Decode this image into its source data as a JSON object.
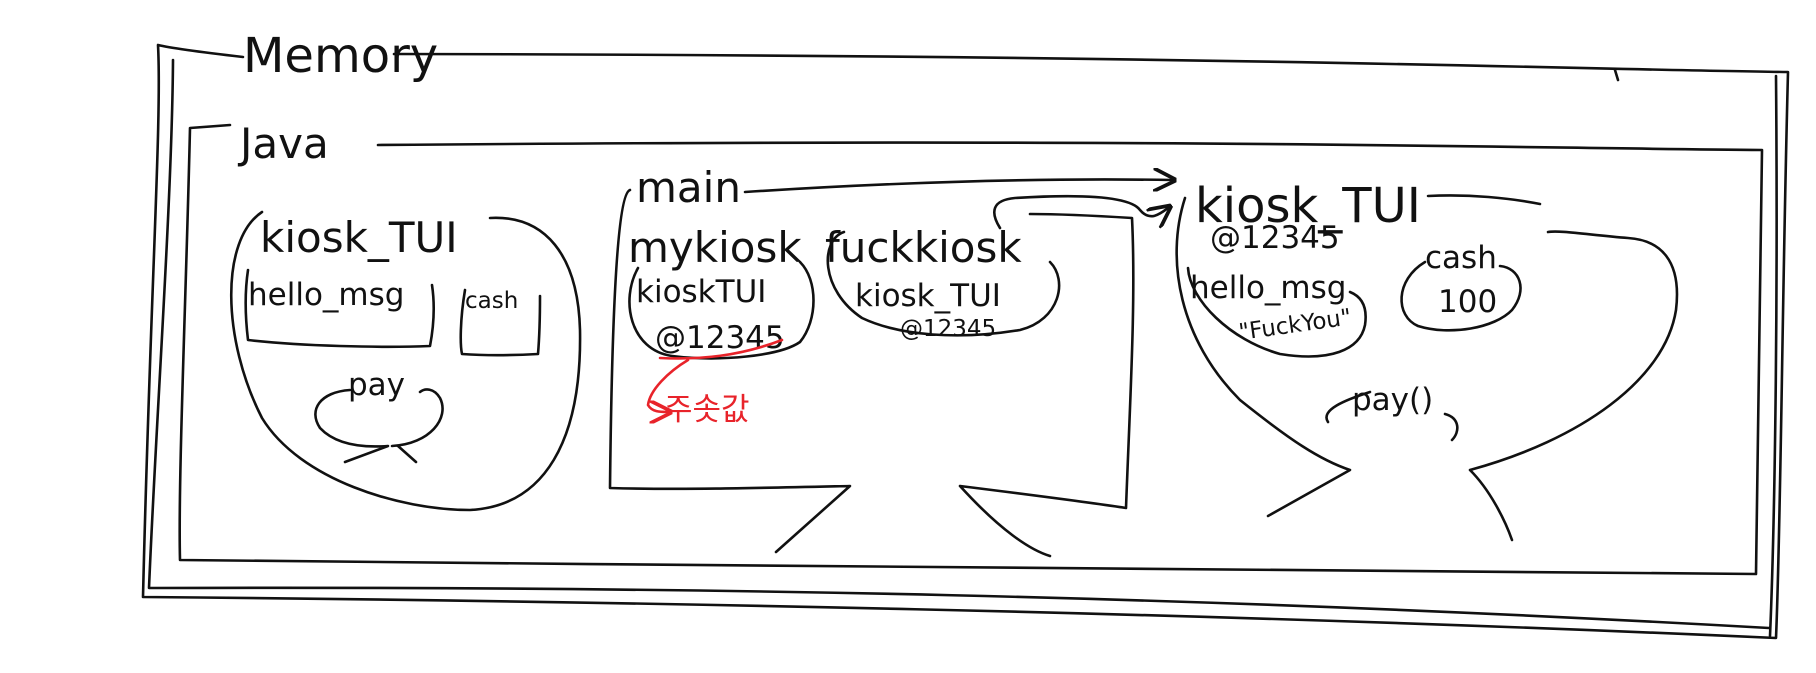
{
  "labels": {
    "memory": "Memory",
    "java": "Java",
    "class_area": {
      "class_name": "kiosk_TUI",
      "field_hello": "hello_msg",
      "field_cash": "cash",
      "method_pay": "pay"
    },
    "main_frame": {
      "title": "main",
      "var_mykiosk": "mykiosk",
      "mykiosk_type": "kioskTUI",
      "mykiosk_addr": "@12345",
      "address_note": "주솟값",
      "var_fuckkiosk": "fuckkiosk",
      "fuckkiosk_type": "kiosk_TUI",
      "fuckkiosk_addr": "@12345"
    },
    "instance": {
      "class_name": "kiosk_TUI",
      "address": "@12345",
      "field_hello": "hello_msg",
      "hello_value": "\"FuckYou\"",
      "field_cash": "cash",
      "cash_value": "100",
      "method_pay": "pay()"
    }
  },
  "colors": {
    "ink": "#111111",
    "annotation": "#e8232a",
    "background": "#ffffff"
  }
}
